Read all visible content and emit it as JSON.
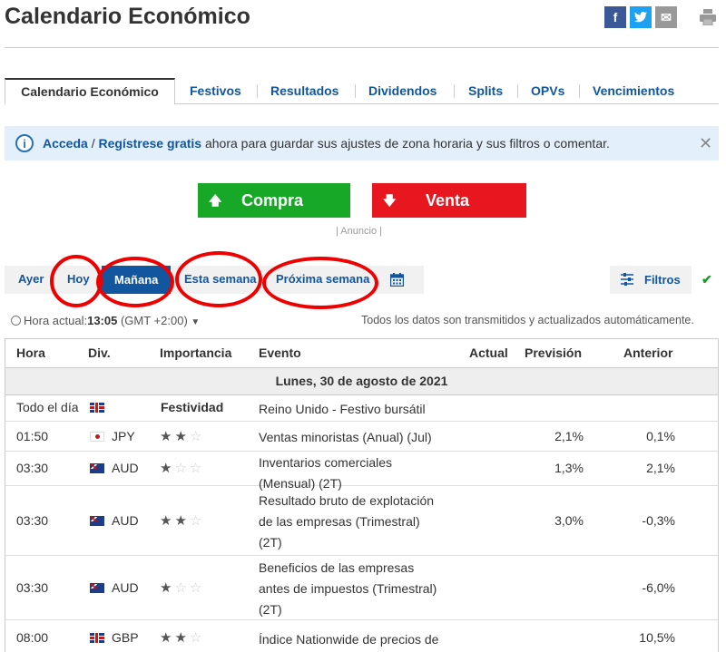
{
  "page": {
    "title": "Calendario Económico"
  },
  "share": {
    "facebook": "f",
    "twitter": "t",
    "email": "✉"
  },
  "tabs": [
    {
      "label": "Calendario Económico"
    },
    {
      "label": "Festivos"
    },
    {
      "label": "Resultados"
    },
    {
      "label": "Dividendos"
    },
    {
      "label": "Splits"
    },
    {
      "label": "OPVs"
    },
    {
      "label": "Vencimientos"
    }
  ],
  "info": {
    "login": "Acceda",
    "separator": " / ",
    "register": "Regístrese gratis",
    "text": " ahora para guardar sus ajustes de zona horaria y sus filtros o comentar."
  },
  "trade": {
    "buy": "Compra",
    "sell": "Venta",
    "ad": "| Anuncio |"
  },
  "colors": {
    "buy": "#17a827",
    "sell": "#e8161e",
    "link": "#1256a0"
  },
  "datebar": {
    "yesterday": "Ayer",
    "today": "Hoy",
    "tomorrow": "Mañana",
    "this_week": "Esta semana",
    "next_week": "Próxima semana"
  },
  "filters": {
    "label": "Filtros"
  },
  "time": {
    "label": "Hora actual:",
    "value": "13:05",
    "tz": "(GMT +2:00)",
    "note": "Todos los datos son transmitidos y actualizados automáticamente."
  },
  "table": {
    "headers": {
      "time": "Hora",
      "currency": "Div.",
      "importance": "Importancia",
      "event": "Evento",
      "actual": "Actual",
      "forecast": "Previsión",
      "previous": "Anterior"
    },
    "date": "Lunes, 30 de agosto de 2021",
    "rows": [
      {
        "time": "Todo el día",
        "currency": "",
        "flag": "uk",
        "importance_text": "Festividad",
        "stars": 0,
        "event": [
          "Reino Unido - Festivo bursátil"
        ],
        "actual": "",
        "forecast": "",
        "previous": ""
      },
      {
        "time": "01:50",
        "currency": "JPY",
        "flag": "jp",
        "stars": 2,
        "event": [
          "Ventas minoristas (Anual) (Jul)"
        ],
        "actual": "",
        "forecast": "2,1%",
        "previous": "0,1%"
      },
      {
        "time": "03:30",
        "currency": "AUD",
        "flag": "au",
        "stars": 1,
        "event": [
          "Inventarios comerciales",
          "(Mensual) (2T)"
        ],
        "actual": "",
        "forecast": "1,3%",
        "previous": "2,1%"
      },
      {
        "time": "03:30",
        "currency": "AUD",
        "flag": "au",
        "stars": 2,
        "event": [
          "Resultado bruto de explotación",
          "de las empresas (Trimestral)",
          "(2T)"
        ],
        "actual": "",
        "forecast": "3,0%",
        "previous": "-0,3%"
      },
      {
        "time": "03:30",
        "currency": "AUD",
        "flag": "au",
        "stars": 1,
        "event": [
          "Beneficios de las empresas",
          "antes de impuestos (Trimestral)",
          "(2T)"
        ],
        "actual": "",
        "forecast": "",
        "previous": "-6,0%"
      },
      {
        "time": "08:00",
        "currency": "GBP",
        "flag": "uk",
        "stars": 2,
        "event": [
          "Índice Nationwide de precios de"
        ],
        "actual": "",
        "forecast": "",
        "previous": "10,5%"
      }
    ]
  }
}
